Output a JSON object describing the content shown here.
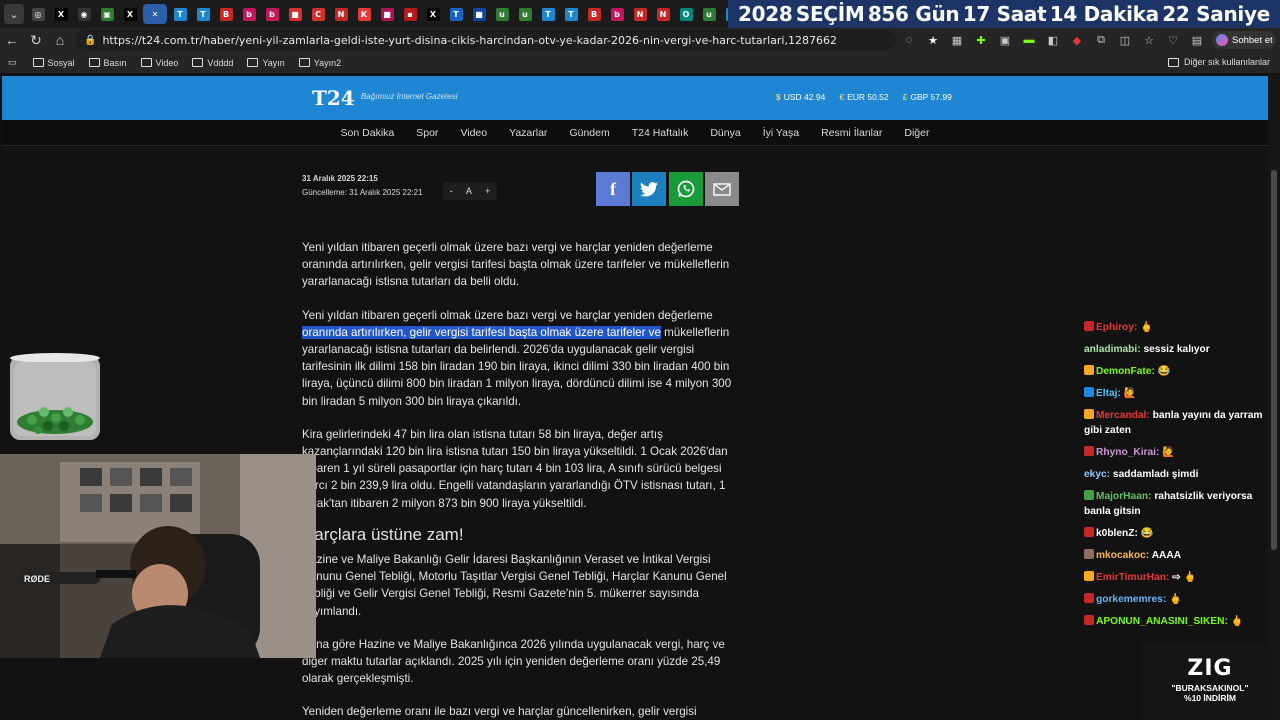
{
  "tabs": {
    "icons": [
      {
        "name": "copilot-tab",
        "glyph": "◎",
        "color": "#444"
      },
      {
        "name": "x-tab",
        "glyph": "X",
        "color": "#000"
      },
      {
        "name": "github-tab",
        "glyph": "◉",
        "color": "#333"
      },
      {
        "name": "app-tab",
        "glyph": "▣",
        "color": "#2e7d32"
      },
      {
        "name": "x-tab",
        "glyph": "X",
        "color": "#000"
      },
      {
        "name": "close-tab",
        "glyph": "✕",
        "color": "#2d5fa8"
      },
      {
        "name": "t24-tab",
        "glyph": "T",
        "color": "#1f86d3"
      },
      {
        "name": "t24-tab",
        "glyph": "T",
        "color": "#1f86d3"
      },
      {
        "name": "b-tab",
        "glyph": "B",
        "color": "#c62828"
      },
      {
        "name": "b-tab",
        "glyph": "b",
        "color": "#c2185b"
      },
      {
        "name": "b-tab",
        "glyph": "b",
        "color": "#c2185b"
      },
      {
        "name": "news-tab",
        "glyph": "■",
        "color": "#d32f2f"
      },
      {
        "name": "c-tab",
        "glyph": "C",
        "color": "#d32f2f"
      },
      {
        "name": "n-tab",
        "glyph": "N",
        "color": "#c62828"
      },
      {
        "name": "k-tab",
        "glyph": "K",
        "color": "#e53935"
      },
      {
        "name": "news-tab",
        "glyph": "■",
        "color": "#ad1457"
      },
      {
        "name": "news-tab",
        "glyph": "▪",
        "color": "#b71c1c"
      },
      {
        "name": "x-tab",
        "glyph": "X",
        "color": "#000"
      },
      {
        "name": "t24-tab",
        "glyph": "T",
        "color": "#1565c0"
      },
      {
        "name": "news-tab",
        "glyph": "■",
        "color": "#0d47a1"
      },
      {
        "name": "up-tab",
        "glyph": "u",
        "color": "#2e7d32"
      },
      {
        "name": "up-tab",
        "glyph": "u",
        "color": "#2e7d32"
      },
      {
        "name": "t24-tab",
        "glyph": "T",
        "color": "#1f86d3"
      },
      {
        "name": "t24-tab",
        "glyph": "T",
        "color": "#1f86d3"
      },
      {
        "name": "b-tab",
        "glyph": "B",
        "color": "#c62828"
      },
      {
        "name": "b-tab",
        "glyph": "b",
        "color": "#c2185b"
      },
      {
        "name": "n-tab",
        "glyph": "N",
        "color": "#c62828"
      },
      {
        "name": "n-tab",
        "glyph": "N",
        "color": "#c62828"
      },
      {
        "name": "o-tab",
        "glyph": "O",
        "color": "#00897b"
      },
      {
        "name": "up-tab",
        "glyph": "u",
        "color": "#2e7d32"
      },
      {
        "name": "t24-tab",
        "glyph": "T",
        "color": "#1f86d3"
      },
      {
        "name": "b-tab",
        "glyph": "b",
        "color": "#c2185b"
      },
      {
        "name": "b-tab",
        "glyph": "b",
        "color": "#c2185b"
      },
      {
        "name": "news-tab",
        "glyph": "▣",
        "color": "#c62828"
      },
      {
        "name": "news-tab",
        "glyph": "◉",
        "color": "#d32f2f"
      },
      {
        "name": "t24-tab",
        "glyph": "T",
        "color": "#1f86d3"
      },
      {
        "name": "news-tab",
        "glyph": "▤",
        "color": "#555"
      }
    ]
  },
  "banner": {
    "year": "2028",
    "label": "SEÇİM",
    "days": "856 Gün",
    "hours": "17 Saat",
    "minutes": "14 Dakika",
    "seconds": "22 Saniye"
  },
  "address": {
    "url": "https://t24.com.tr/haber/yeni-yil-zamlarla-geldi-iste-yurt-disina-cikis-harcindan-otv-ye-kadar-2026-nin-vergi-ve-harc-tutarlari,1287662"
  },
  "chat_button": {
    "label": "Sohbet et"
  },
  "bookmarks": {
    "items": [
      "Sosyal",
      "Basın",
      "Video",
      "Vdddd",
      "Yayın",
      "Yayın2"
    ],
    "other": "Diğer sık kullanılanlar"
  },
  "site": {
    "logo": "T24",
    "tagline": "Bağımsız İnternet Gazetesi",
    "rates": [
      {
        "cur": "$",
        "label": "USD 42.94"
      },
      {
        "cur": "€",
        "label": "EUR 50.52"
      },
      {
        "cur": "£",
        "label": "GBP 57.99"
      }
    ],
    "nav": [
      "Son Dakika",
      "Spor",
      "Video",
      "Yazarlar",
      "Gündem",
      "T24 Haftalık",
      "Dünya",
      "İyi Yaşa",
      "Resmi İlanlar",
      "Diğer"
    ]
  },
  "meta": {
    "date": "31 Aralık 2025 22:15",
    "updated": "Güncelleme: 31 Aralık 2025 22:21",
    "font_minus": "-",
    "font_a": "A",
    "font_plus": "+"
  },
  "article": {
    "p1": "Yeni yıldan itibaren geçerli olmak üzere bazı vergi ve harçlar yeniden değerleme oranında artırılırken, gelir vergisi tarifesi başta olmak üzere tarifeler ve mükelleflerin yararlanacağı istisna tutarları da belli oldu.",
    "p2a": "Yeni yıldan itibaren geçerli olmak üzere bazı vergi ve harçlar yeniden değerleme ",
    "p2hl": "oranında artırılırken, gelir vergisi tarifesi başta olmak üzere tarifeler ve",
    "p2b": " mükelleflerin yararlanacağı istisna tutarları da belirlendi. 2026'da uygulanacak gelir vergisi tarifesinin ilk dilimi 158 bin liradan 190 bin liraya, ikinci dilimi 330 bin liradan 400 bin liraya, üçüncü dilimi 800 bin liradan 1 milyon liraya, dördüncü dilimi ise 4 milyon 300 bin liradan 5 milyon 300 bin liraya çıkarıldı.",
    "p3": "Kira gelirlerindeki 47 bin lira olan istisna tutarı 58 bin liraya, değer artış kazançlarındaki 120 bin lira istisna tutarı 150 bin liraya yükseltildi. 1 Ocak 2026'dan itibaren 1 yıl süreli pasaportlar için harç tutarı 4 bin 103 lira, A sınıfı sürücü belgesi harcı 2 bin 239,9 lira oldu. Engelli vatandaşların yararlandığı ÖTV istisnası tutarı, 1 Ocak'tan itibaren 2 milyon 873 bin 900 liraya yükseltildi.",
    "h2": "Harçlara üstüne zam!",
    "p4": "Hazine ve Maliye Bakanlığı Gelir İdaresi Başkanlığının Veraset ve İntikal Vergisi Kanunu Genel Tebliği, Motorlu Taşıtlar Vergisi Genel Tebliği, Harçlar Kanunu Genel Tebliği ve Gelir Vergisi Genel Tebliği, Resmi Gazete'nin 5. mükerrer sayısında yayımlandı.",
    "p5": "Buna göre Hazine ve Maliye Bakanlığınca 2026 yılında uygulanacak vergi, harç ve diğer maktu tutarlar açıklandı. 2025 yılı için yeniden değerleme oranı yüzde 25,49 olarak gerçekleşmişti.",
    "p6": "Yeniden değerleme oranı ile bazı vergi ve harçlar güncellenirken, gelir vergisi"
  },
  "chat": [
    {
      "user": "Ephiroy:",
      "color": "#e53935",
      "text": "🖕",
      "badge": "#c62828"
    },
    {
      "user": "anladimabi:",
      "color": "#a6e3a1",
      "text": "sessiz kalıyor",
      "badge": ""
    },
    {
      "user": "DemonFate:",
      "color": "#7CFC00",
      "text": "😂",
      "badge": "#f9a825"
    },
    {
      "user": "Eltaj:",
      "color": "#4fc3f7",
      "text": "🙋",
      "badge": "#1e88e5"
    },
    {
      "user": "Mercandal:",
      "color": "#e53935",
      "text": "banla yayını da yarram gibi zaten",
      "badge": "#f9a825"
    },
    {
      "user": "Rhyno_Kirai:",
      "color": "#ce93d8",
      "text": "🙋",
      "badge": "#c62828"
    },
    {
      "user": "ekyc:",
      "color": "#90caf9",
      "text": "saddamladı şimdi",
      "badge": ""
    },
    {
      "user": "MajorHaan:",
      "color": "#66bb6a",
      "text": "rahatsizlik veriyorsa banla gitsin",
      "badge": "#43a047"
    },
    {
      "user": "k0blenZ:",
      "color": "#ffffff",
      "text": "😂",
      "badge": "#c62828"
    },
    {
      "user": "mkocakoc:",
      "color": "#ffb74d",
      "text": "AAAA",
      "badge": "#8d6e63"
    },
    {
      "user": "EmirTimurHan:",
      "color": "#e53935",
      "text": "⇨ 🖕",
      "badge": "#f9a825"
    },
    {
      "user": "gorkememres:",
      "color": "#64b5f6",
      "text": "🖕",
      "badge": "#c62828"
    },
    {
      "user": "APONUN_ANASINI_SIKEN:",
      "color": "#7CFC00",
      "text": "🖕",
      "badge": "#c62828"
    }
  ],
  "promo": {
    "logo": "ZIG",
    "code": "\"BURAKSAKINOL\"",
    "discount": "%10 İNDİRİM"
  },
  "cam": {
    "mic_brand": "RØDE"
  }
}
